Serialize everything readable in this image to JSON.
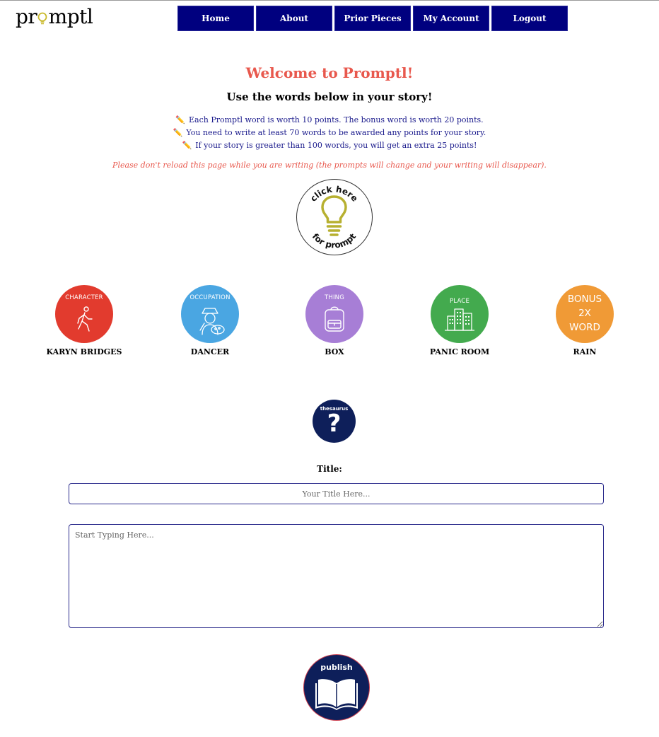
{
  "brand": {
    "logo_text_pre": "pr",
    "logo_text_post": "mptl"
  },
  "nav": {
    "items": [
      {
        "label": "Home"
      },
      {
        "label": "About"
      },
      {
        "label": "Prior Pieces"
      },
      {
        "label": "My Account"
      },
      {
        "label": "Logout"
      }
    ]
  },
  "header": {
    "welcome": "Welcome to Promptl!",
    "subtitle": "Use the words below in your story!"
  },
  "rules": [
    "Each Promptl word is worth 10 points. The bonus word is worth 20 points.",
    "You need to write at least 70 words to be awarded any points for your story.",
    "If your story is greater than 100 words, you will get an extra 25 points!"
  ],
  "warning": "Please don't reload this page while you are writing (the prompts will change and your writing will disappear).",
  "prompt_button": {
    "top_text": "click here",
    "bottom_text": "for prompt",
    "icon": "lightbulb-icon"
  },
  "words": [
    {
      "category": "CHARACTER",
      "word": "KARYN BRIDGES",
      "color": "#e23b2e",
      "icon": "walking-person-icon"
    },
    {
      "category": "OCCUPATION",
      "word": "DANCER",
      "color": "#4aa6e2",
      "icon": "artist-palette-icon"
    },
    {
      "category": "THING",
      "word": "BOX",
      "color": "#a77ed6",
      "icon": "backpack-icon"
    },
    {
      "category": "PLACE",
      "word": "PANIC ROOM",
      "color": "#43aa4e",
      "icon": "buildings-icon"
    },
    {
      "category": "BONUS\n2X\nWORD",
      "word": "RAIN",
      "color": "#f09a36",
      "icon": ""
    }
  ],
  "thesaurus": {
    "label": "thesaurus",
    "glyph": "?"
  },
  "form": {
    "title_label": "Title:",
    "title_placeholder": "Your Title Here...",
    "story_placeholder": "Start Typing Here..."
  },
  "publish": {
    "label": "publish",
    "icon": "open-book-icon"
  },
  "colors": {
    "nav_bg": "#00007f",
    "accent_red": "#e8584d",
    "rule_blue": "#1a1a8c",
    "button_navy": "#0e1f5a",
    "bulb_olive": "#b7b030"
  }
}
